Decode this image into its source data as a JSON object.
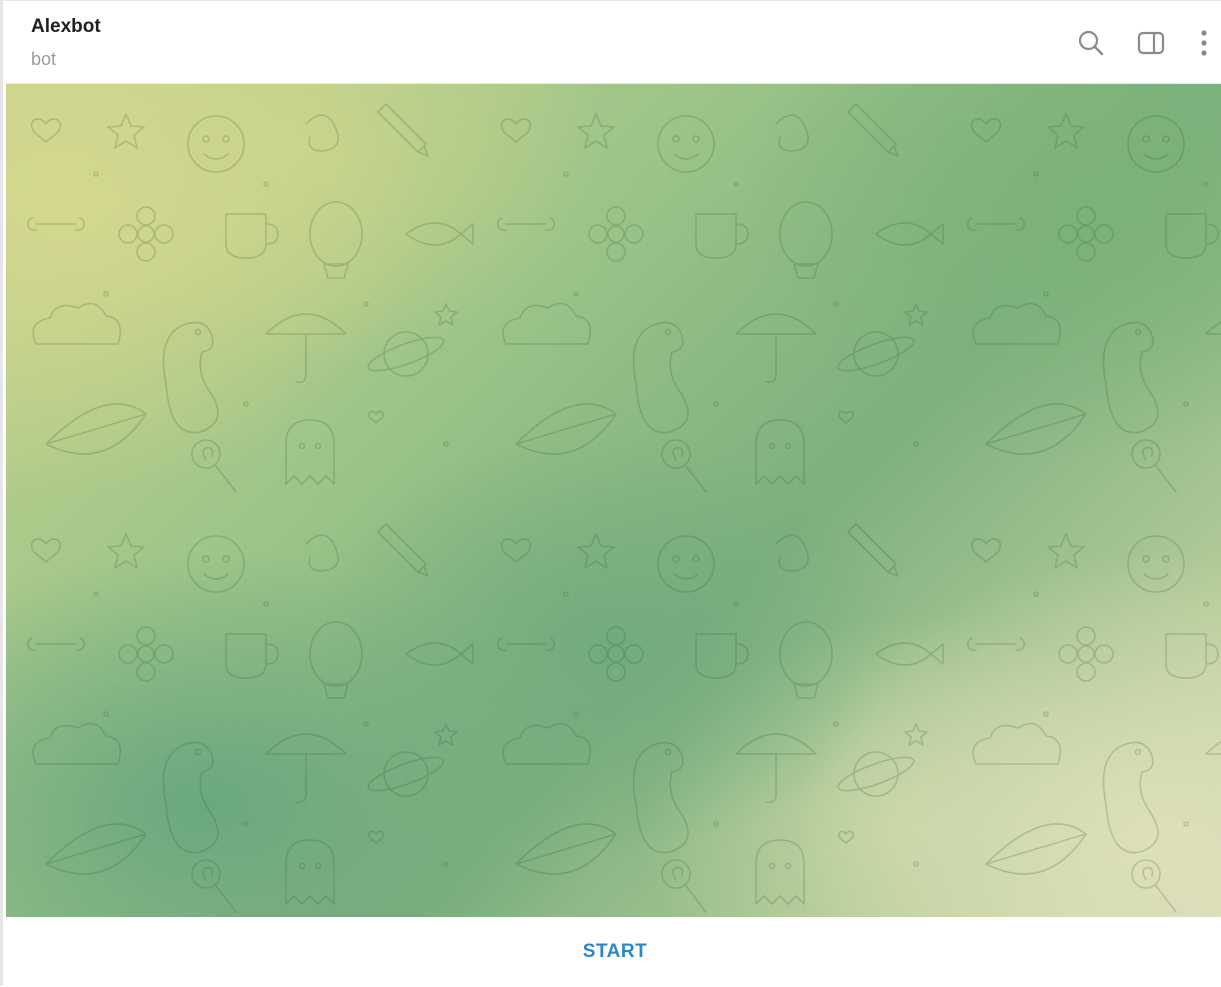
{
  "header": {
    "title": "Alexbot",
    "subtitle": "bot",
    "icons": [
      "search-icon",
      "side-panel-icon",
      "more-vertical-icon"
    ]
  },
  "chat": {
    "background": "doodle-pattern",
    "colors": {
      "yellow_green": "#c9d48e",
      "mid_green": "#7db07e",
      "pale_cream": "#d7dcb5"
    }
  },
  "footer": {
    "start_label": "START",
    "accent_color": "#2a87c8"
  }
}
